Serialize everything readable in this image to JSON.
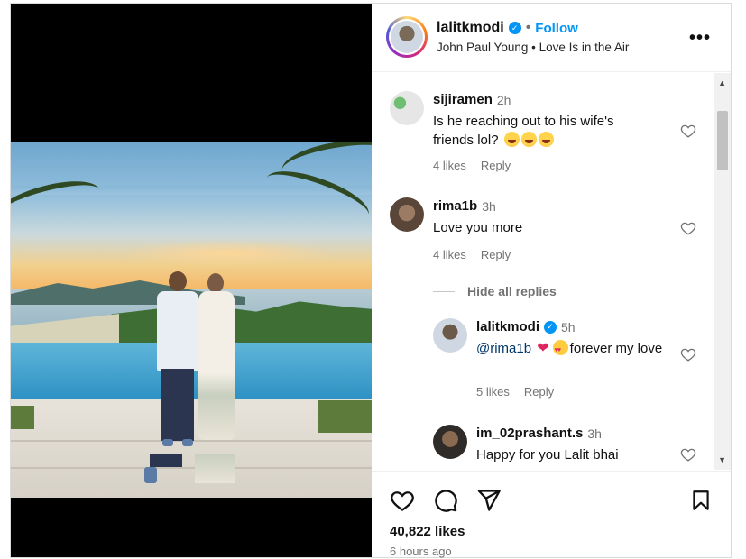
{
  "post": {
    "username": "lalitkmodi",
    "follow_label": "Follow",
    "separator": "•",
    "music": "John Paul Young • Love Is in the Air",
    "more_icon": "more-horizontal-icon"
  },
  "comments": [
    {
      "username": "sijiramen",
      "time": "2h",
      "text": "Is he reaching out to his wife's friends lol?",
      "likes": "4 likes",
      "reply_label": "Reply",
      "emoji": "laughing-emoji x3"
    },
    {
      "username": "rima1b",
      "time": "3h",
      "text": "Love you more",
      "likes": "4 likes",
      "reply_label": "Reply"
    },
    {
      "hide_replies_label": "Hide all replies"
    },
    {
      "username": "lalitkmodi",
      "time": "5h",
      "mention": "@rima1b",
      "text_after": "forever my love",
      "likes": "5 likes",
      "reply_label": "Reply",
      "verified": true
    },
    {
      "username": "im_02prashant.s",
      "time": "3h",
      "text": "Happy for you Lalit bhai"
    }
  ],
  "footer": {
    "likes": "40,822 likes",
    "time_ago": "6 hours ago",
    "icons": [
      "heart-icon",
      "comment-icon",
      "share-icon",
      "bookmark-icon"
    ]
  },
  "colors": {
    "accent": "#0095f6",
    "muted": "#737373"
  }
}
